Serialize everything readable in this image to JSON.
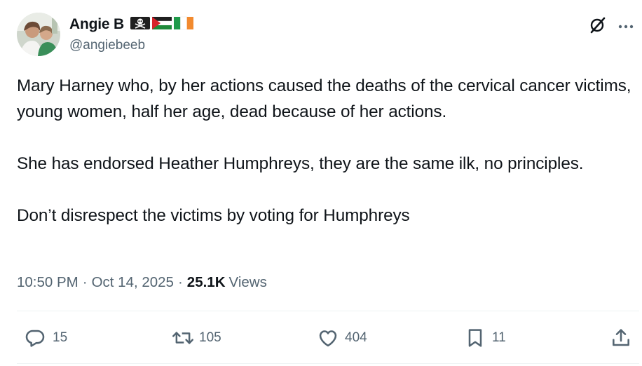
{
  "author": {
    "display_name": "Angie B",
    "handle": "@angiebeeb",
    "avatar_icon": "profile-photo",
    "flags": [
      "pirate-flag-icon",
      "palestine-flag-icon",
      "ireland-flag-icon"
    ]
  },
  "header_icons": {
    "grok": "grok-icon",
    "more": "more-icon"
  },
  "tweet": {
    "paragraphs": [
      "Mary Harney who, by her actions caused the deaths of the cervical cancer victims, young women, half her age, dead because of her actions.",
      "She has endorsed Heather Humphreys, they are the same ilk, no principles.",
      "Don’t disrespect the victims by voting for Humphreys"
    ],
    "time": "10:50 PM",
    "date": "Oct 14, 2025",
    "separator": "·",
    "views_count": "25.1K",
    "views_label": "Views"
  },
  "actions": {
    "replies": "15",
    "reposts": "105",
    "likes": "404",
    "bookmarks": "11"
  },
  "colors": {
    "text": "#0f1419",
    "secondary": "#536471",
    "divider": "#eff3f4"
  }
}
